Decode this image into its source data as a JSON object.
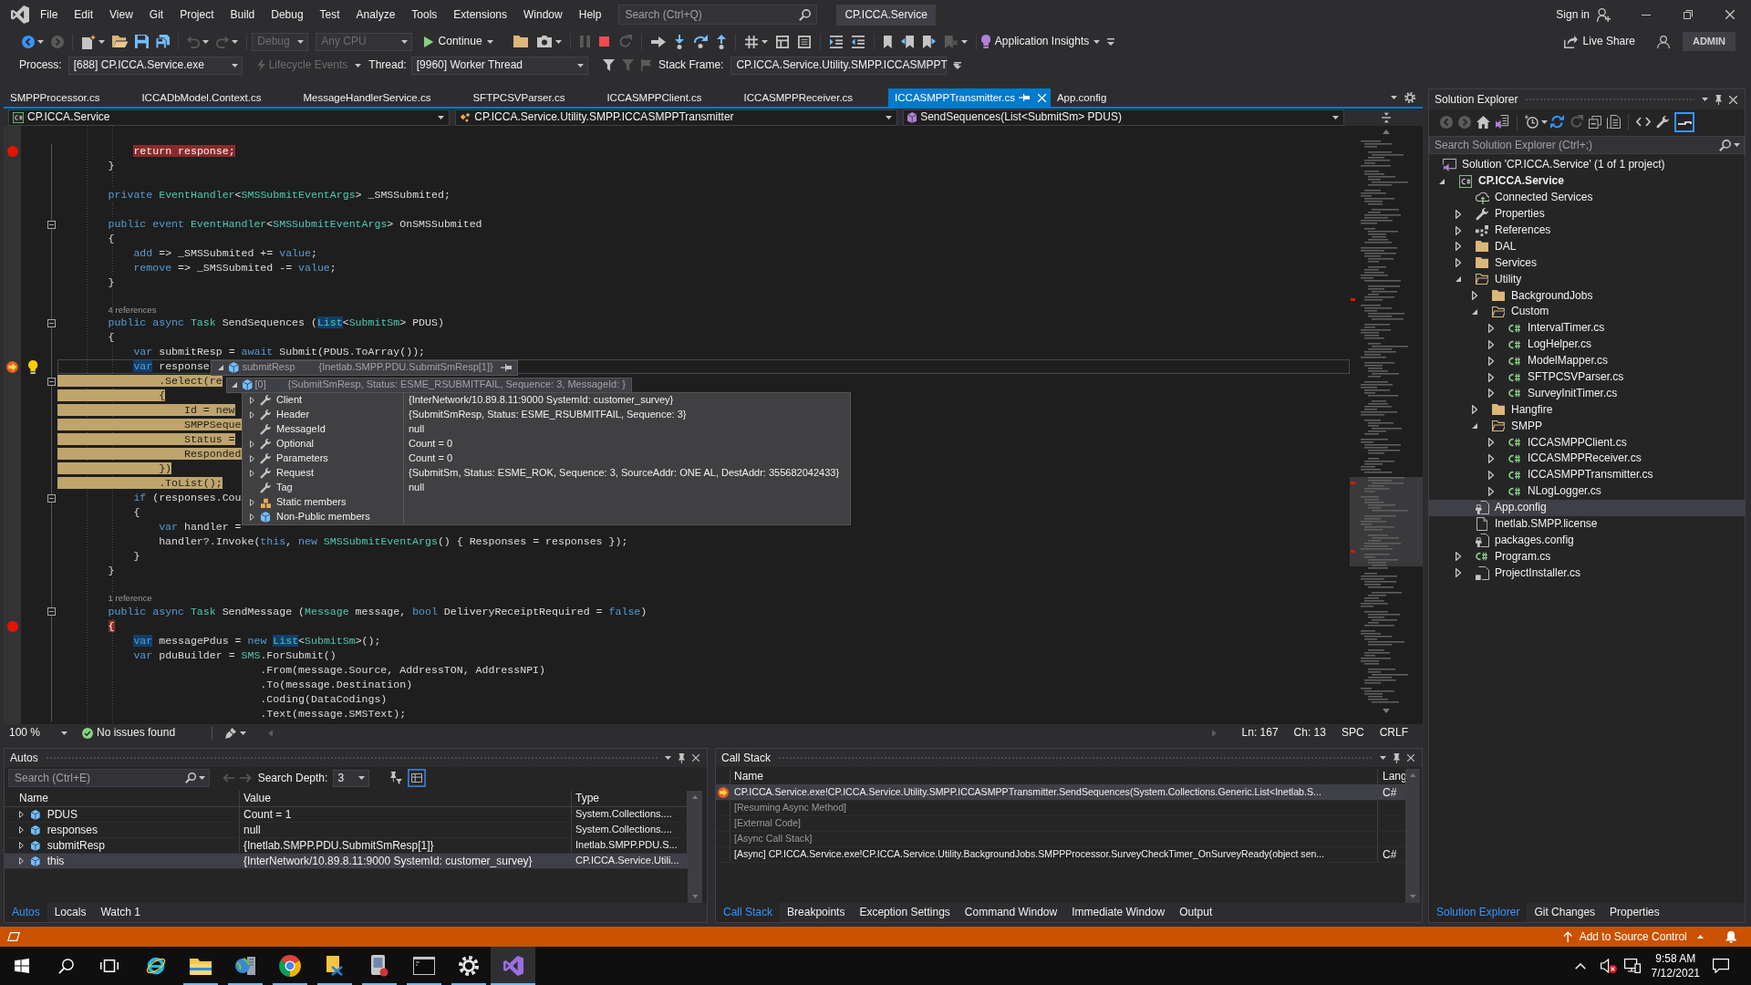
{
  "title_bar": {
    "menu": [
      "File",
      "Edit",
      "View",
      "Git",
      "Project",
      "Build",
      "Debug",
      "Test",
      "Analyze",
      "Tools",
      "Extensions",
      "Window",
      "Help"
    ],
    "search": {
      "placeholder": "Search (Ctrl+Q)"
    },
    "solution_name": "CP.ICCA.Service",
    "sign_in": "Sign in"
  },
  "toolbar": {
    "configuration": {
      "value": "Debug",
      "disabled": true
    },
    "platform": {
      "value": "Any CPU",
      "disabled": true
    },
    "continue": "Continue",
    "insights": "Application Insights",
    "live_share": "Live Share",
    "account": "ADMIN"
  },
  "debug_location": {
    "process_label": "Process:",
    "process": "[688] CP.ICCA.Service.exe",
    "lifecycle": {
      "label": "Lifecycle Events",
      "disabled": true
    },
    "thread_label": "Thread:",
    "thread": "[9960] Worker Thread",
    "stack_frame_label": "Stack Frame:",
    "stack_frame": "CP.ICCA.Service.Utility.SMPP.ICCASMPPT"
  },
  "document_tabs": [
    {
      "label": "SMPPProcessor.cs",
      "selected": false
    },
    {
      "label": "ICCADbModel.Context.cs",
      "selected": false
    },
    {
      "label": "MessageHandlerService.cs",
      "selected": false
    },
    {
      "label": "SFTPCSVParser.cs",
      "selected": false
    },
    {
      "label": "ICCASMPPClient.cs",
      "selected": false
    },
    {
      "label": "ICCASMPPReceiver.cs",
      "selected": false
    },
    {
      "label": "ICCASMPPTransmitter.cs",
      "selected": true
    },
    {
      "label": "App.config",
      "selected": false
    }
  ],
  "editor": {
    "navigation": [
      "CP.ICCA.Service",
      "CP.ICCA.Service.Utility.SMPP.ICCASMPPTransmitter",
      "SendSequences(List<SubmitSm> PDUS)"
    ],
    "lines": [
      {
        "kind": "breakpoint",
        "fold": false,
        "tokens": [
          {
            "text": "            return",
            "kind": "keyword"
          },
          {
            "text": " response;",
            "kind": "plain"
          }
        ]
      },
      {
        "kind": "code",
        "fold": false,
        "tokens": [
          {
            "text": "        }",
            "kind": "plain"
          }
        ]
      },
      {
        "kind": "blank"
      },
      {
        "kind": "code",
        "fold": false,
        "tokens": [
          {
            "text": "        private ",
            "kind": "keyword"
          },
          {
            "text": "EventHandler",
            "kind": "type"
          },
          {
            "text": "<",
            "kind": "plain"
          },
          {
            "text": "SMSSubmitEventArgs",
            "kind": "type"
          },
          {
            "text": "> _SMSSubmited;",
            "kind": "plain"
          }
        ]
      },
      {
        "kind": "blank"
      },
      {
        "kind": "code",
        "fold": true,
        "tokens": [
          {
            "text": "        public event ",
            "kind": "keyword"
          },
          {
            "text": "EventHandler",
            "kind": "type"
          },
          {
            "text": "<",
            "kind": "plain"
          },
          {
            "text": "SMSSubmitEventArgs",
            "kind": "type"
          },
          {
            "text": "> OnSMSSubmited",
            "kind": "plain"
          }
        ]
      },
      {
        "kind": "code",
        "fold": false,
        "tokens": [
          {
            "text": "        {",
            "kind": "plain"
          }
        ]
      },
      {
        "kind": "code",
        "fold": false,
        "tokens": [
          {
            "text": "            add",
            "kind": "keyword"
          },
          {
            "text": " => _SMSSubmited += ",
            "kind": "plain"
          },
          {
            "text": "value",
            "kind": "keyword"
          },
          {
            "text": ";",
            "kind": "plain"
          }
        ]
      },
      {
        "kind": "code",
        "fold": false,
        "tokens": [
          {
            "text": "            remove",
            "kind": "keyword"
          },
          {
            "text": " => _SMSSubmited -= ",
            "kind": "plain"
          },
          {
            "text": "value",
            "kind": "keyword"
          },
          {
            "text": ";",
            "kind": "plain"
          }
        ]
      },
      {
        "kind": "code",
        "fold": false,
        "tokens": [
          {
            "text": "        }",
            "kind": "plain"
          }
        ]
      },
      {
        "kind": "blank"
      },
      {
        "kind": "lens",
        "tokens": [
          {
            "text": "        4 references",
            "kind": "plain"
          }
        ]
      },
      {
        "kind": "code",
        "fold": true,
        "tokens": [
          {
            "text": "        public async ",
            "kind": "keyword"
          },
          {
            "text": "Task",
            "kind": "type"
          },
          {
            "text": " SendSequences (",
            "kind": "plain"
          },
          {
            "text": "List",
            "kind": "typeref"
          },
          {
            "text": "<",
            "kind": "plain"
          },
          {
            "text": "SubmitSm",
            "kind": "type"
          },
          {
            "text": "> PDUS)",
            "kind": "plain"
          }
        ]
      },
      {
        "kind": "code",
        "fold": false,
        "tokens": [
          {
            "text": "        {",
            "kind": "plain"
          }
        ]
      },
      {
        "kind": "code",
        "fold": false,
        "tokens": [
          {
            "text": "            var",
            "kind": "keyword"
          },
          {
            "text": " submitResp = ",
            "kind": "plain"
          },
          {
            "text": "await",
            "kind": "keyword"
          },
          {
            "text": " Submit(PDUS.ToArray());",
            "kind": "plain"
          }
        ]
      },
      {
        "kind": "current",
        "fold": false,
        "tokens": [
          {
            "text": "            var",
            "kind": "keywordref"
          },
          {
            "text": " response",
            "kind": "plain"
          }
        ]
      },
      {
        "kind": "statement",
        "fold": true,
        "tokens": [
          {
            "text": "                .Select(re",
            "kind": "plain"
          }
        ]
      },
      {
        "kind": "statement",
        "fold": false,
        "tokens": [
          {
            "text": "                {",
            "kind": "plain"
          }
        ]
      },
      {
        "kind": "statement",
        "fold": false,
        "tokens": [
          {
            "text": "                    Id = ",
            "kind": "plain"
          },
          {
            "text": "new",
            "kind": "keyword"
          }
        ]
      },
      {
        "kind": "statement",
        "fold": false,
        "tokens": [
          {
            "text": "                    SMPPSeque",
            "kind": "plain"
          }
        ]
      },
      {
        "kind": "statement",
        "fold": false,
        "tokens": [
          {
            "text": "                    Status =",
            "kind": "plain"
          }
        ]
      },
      {
        "kind": "statement",
        "fold": false,
        "tokens": [
          {
            "text": "                    Responded",
            "kind": "plain"
          }
        ]
      },
      {
        "kind": "statement",
        "fold": false,
        "tokens": [
          {
            "text": "                })",
            "kind": "plain"
          }
        ]
      },
      {
        "kind": "statement",
        "fold": false,
        "tokens": [
          {
            "text": "                .ToList();",
            "kind": "plain"
          }
        ]
      },
      {
        "kind": "code",
        "fold": true,
        "tokens": [
          {
            "text": "            if",
            "kind": "keyword"
          },
          {
            "text": " (responses.Cou",
            "kind": "plain"
          }
        ]
      },
      {
        "kind": "code",
        "fold": false,
        "tokens": [
          {
            "text": "            {",
            "kind": "plain"
          }
        ]
      },
      {
        "kind": "code",
        "fold": false,
        "tokens": [
          {
            "text": "                var",
            "kind": "keyword"
          },
          {
            "text": " handler =",
            "kind": "plain"
          }
        ]
      },
      {
        "kind": "code",
        "fold": false,
        "tokens": [
          {
            "text": "                handler?.Invoke(",
            "kind": "plain"
          },
          {
            "text": "this",
            "kind": "keyword"
          },
          {
            "text": ", ",
            "kind": "plain"
          },
          {
            "text": "new ",
            "kind": "keyword"
          },
          {
            "text": "SMSSubmitEventArgs",
            "kind": "type"
          },
          {
            "text": "() { Responses = responses });",
            "kind": "plain"
          }
        ]
      },
      {
        "kind": "code",
        "fold": false,
        "tokens": [
          {
            "text": "            }",
            "kind": "plain"
          }
        ]
      },
      {
        "kind": "code",
        "fold": false,
        "tokens": [
          {
            "text": "        }",
            "kind": "plain"
          }
        ]
      },
      {
        "kind": "blank"
      },
      {
        "kind": "lens",
        "tokens": [
          {
            "text": "        1 reference",
            "kind": "plain"
          }
        ]
      },
      {
        "kind": "code",
        "fold": true,
        "tokens": [
          {
            "text": "        public async ",
            "kind": "keyword"
          },
          {
            "text": "Task",
            "kind": "type"
          },
          {
            "text": " SendMessage (",
            "kind": "plain"
          },
          {
            "text": "Message",
            "kind": "type"
          },
          {
            "text": " message, ",
            "kind": "plain"
          },
          {
            "text": "bool",
            "kind": "keyword"
          },
          {
            "text": " DeliveryReceiptRequired = ",
            "kind": "plain"
          },
          {
            "text": "false",
            "kind": "keyword"
          },
          {
            "text": ")",
            "kind": "plain"
          }
        ]
      },
      {
        "kind": "breakpoint",
        "fold": false,
        "tokens": [
          {
            "text": "        {",
            "kind": "plain"
          }
        ]
      },
      {
        "kind": "code",
        "fold": false,
        "tokens": [
          {
            "text": "            var",
            "kind": "keywordref"
          },
          {
            "text": " messagePdus = ",
            "kind": "plain"
          },
          {
            "text": "new ",
            "kind": "keyword"
          },
          {
            "text": "List",
            "kind": "typeref"
          },
          {
            "text": "<",
            "kind": "plain"
          },
          {
            "text": "SubmitSm",
            "kind": "type"
          },
          {
            "text": ">();",
            "kind": "plain"
          }
        ]
      },
      {
        "kind": "code",
        "fold": false,
        "tokens": [
          {
            "text": "            var",
            "kind": "keyword"
          },
          {
            "text": " pduBuilder = ",
            "kind": "plain"
          },
          {
            "text": "SMS",
            "kind": "type"
          },
          {
            "text": ".ForSubmit()",
            "kind": "plain"
          }
        ]
      },
      {
        "kind": "code",
        "fold": false,
        "tokens": [
          {
            "text": "                                .From(message.Source, AddressTON, AddressNPI)",
            "kind": "plain"
          }
        ]
      },
      {
        "kind": "code",
        "fold": false,
        "tokens": [
          {
            "text": "                                .To(message.Destination)",
            "kind": "plain"
          }
        ]
      },
      {
        "kind": "code",
        "fold": false,
        "tokens": [
          {
            "text": "                                .Coding(DataCodings)",
            "kind": "plain"
          }
        ]
      },
      {
        "kind": "code",
        "fold": false,
        "tokens": [
          {
            "text": "                                .Text(message.SMSText);",
            "kind": "plain"
          }
        ]
      }
    ],
    "datatip": {
      "rows": [
        {
          "name": "submitResp",
          "value": "{Inetlab.SMPP.PDU.SubmitSmResp[1]}",
          "expanded": true
        },
        {
          "name": "[0]",
          "value": "{SubmitSmResp, Status: ESME_RSUBMITFAIL, Sequence: 3, MessageId: }",
          "expanded": true
        }
      ],
      "members": [
        {
          "name": "Client",
          "value": "{InterNetwork/10.89.8.11:9000 SystemId: customer_survey}",
          "kind": "property",
          "expanded": false
        },
        {
          "name": "Header",
          "value": "{SubmitSmResp, Status: ESME_RSUBMITFAIL, Sequence: 3}",
          "kind": "property",
          "expanded": false
        },
        {
          "name": "MessageId",
          "value": "null",
          "kind": "property"
        },
        {
          "name": "Optional",
          "value": "Count = 0",
          "kind": "property",
          "expanded": false
        },
        {
          "name": "Parameters",
          "value": "Count = 0",
          "kind": "property",
          "expanded": false
        },
        {
          "name": "Request",
          "value": "{SubmitSm, Status: ESME_ROK, Sequence: 3, SourceAddr: ONE AL, DestAddr: 355682042433}",
          "kind": "property",
          "expanded": false
        },
        {
          "name": "Tag",
          "value": "null",
          "kind": "property"
        },
        {
          "name": "Static members",
          "kind": "static",
          "expanded": false
        },
        {
          "name": "Non-Public members",
          "kind": "nonpublic",
          "expanded": false
        }
      ]
    },
    "status": {
      "zoom": "100 %",
      "issues": "No issues found",
      "line": "Ln: 167",
      "column": "Ch: 13",
      "whitespace": "SPC",
      "line_ending": "CRLF"
    }
  },
  "autos": {
    "title": "Autos",
    "search": {
      "placeholder": "Search (Ctrl+E)"
    },
    "search_depth_label": "Search Depth:",
    "search_depth": "3",
    "columns": [
      "Name",
      "Value",
      "Type"
    ],
    "rows": [
      {
        "name": "PDUS",
        "value": "Count = 1",
        "type": "System.Collections....",
        "expanded": false,
        "selected": false
      },
      {
        "name": "responses",
        "value": "null",
        "type": "System.Collections....",
        "expanded": false,
        "selected": false
      },
      {
        "name": "submitResp",
        "value": "{Inetlab.SMPP.PDU.SubmitSmResp[1]}",
        "type": "Inetlab.SMPP.PDU.S...",
        "expanded": false,
        "selected": false
      },
      {
        "name": "this",
        "value": "{InterNetwork/10.89.8.11:9000 SystemId: customer_survey}",
        "type": "CP.ICCA.Service.Utili...",
        "expanded": false,
        "selected": true
      }
    ],
    "tabs": [
      {
        "label": "Autos",
        "selected": true
      },
      {
        "label": "Locals",
        "selected": false
      },
      {
        "label": "Watch 1",
        "selected": false
      }
    ]
  },
  "call_stack": {
    "title": "Call Stack",
    "columns": [
      "Name",
      "Lang"
    ],
    "rows": [
      {
        "name": "CP.ICCA.Service.exe!CP.ICCA.Service.Utility.SMPP.ICCASMPPTransmitter.SendSequences(System.Collections.Generic.List<Inetlab.S...",
        "language": "C#",
        "kind": "current",
        "selected": true
      },
      {
        "name": "[Resuming Async Method]",
        "kind": "external",
        "selected": false
      },
      {
        "name": "[External Code]",
        "kind": "external",
        "selected": false
      },
      {
        "name": "[Async Call Stack]",
        "kind": "external",
        "selected": false
      },
      {
        "name": "[Async] CP.ICCA.Service.exe!CP.ICCA.Service.Utility.BackgroundJobs.SMPPProcessor.SurveyCheckTimer_OnSurveyReady(object sen...",
        "language": "C#",
        "kind": "frame",
        "selected": false
      }
    ],
    "tabs": [
      {
        "label": "Call Stack",
        "selected": true
      },
      {
        "label": "Breakpoints",
        "selected": false
      },
      {
        "label": "Exception Settings",
        "selected": false
      },
      {
        "label": "Command Window",
        "selected": false
      },
      {
        "label": "Immediate Window",
        "selected": false
      },
      {
        "label": "Output",
        "selected": false
      }
    ]
  },
  "solution_explorer": {
    "title": "Solution Explorer",
    "search": {
      "placeholder": "Search Solution Explorer (Ctrl+;)"
    },
    "tree": [
      {
        "label": "Solution 'CP.ICCA.Service' (1 of 1 project)",
        "kind": "solution",
        "selected": false,
        "children": [
          {
            "label": "CP.ICCA.Service",
            "kind": "project",
            "expanded": true,
            "selected": false,
            "children": [
              {
                "label": "Connected Services",
                "kind": "connected",
                "selected": false
              },
              {
                "label": "Properties",
                "kind": "properties",
                "expanded": false,
                "selected": false
              },
              {
                "label": "References",
                "kind": "references",
                "expanded": false,
                "selected": false
              },
              {
                "label": "DAL",
                "kind": "folder",
                "expanded": false,
                "selected": false
              },
              {
                "label": "Services",
                "kind": "folder",
                "expanded": false,
                "selected": false
              },
              {
                "label": "Utility",
                "kind": "folder",
                "expanded": true,
                "selected": false,
                "children": [
                  {
                    "label": "BackgroundJobs",
                    "kind": "folder",
                    "expanded": false,
                    "selected": false
                  },
                  {
                    "label": "Custom",
                    "kind": "folder",
                    "expanded": true,
                    "selected": false,
                    "children": [
                      {
                        "label": "IntervalTimer.cs",
                        "kind": "csharp",
                        "expanded": false,
                        "selected": false
                      },
                      {
                        "label": "LogHelper.cs",
                        "kind": "csharp",
                        "expanded": false,
                        "selected": false
                      },
                      {
                        "label": "ModelMapper.cs",
                        "kind": "csharp",
                        "expanded": false,
                        "selected": false
                      },
                      {
                        "label": "SFTPCSVParser.cs",
                        "kind": "csharp",
                        "expanded": false,
                        "selected": false
                      },
                      {
                        "label": "SurveyInitTimer.cs",
                        "kind": "csharp",
                        "expanded": false,
                        "selected": false
                      }
                    ]
                  },
                  {
                    "label": "Hangfire",
                    "kind": "folder",
                    "expanded": false,
                    "selected": false
                  },
                  {
                    "label": "SMPP",
                    "kind": "folder",
                    "expanded": true,
                    "selected": false,
                    "children": [
                      {
                        "label": "ICCASMPPClient.cs",
                        "kind": "csharp",
                        "expanded": false,
                        "selected": false
                      },
                      {
                        "label": "ICCASMPPReceiver.cs",
                        "kind": "csharp",
                        "expanded": false,
                        "selected": false
                      },
                      {
                        "label": "ICCASMPPTransmitter.cs",
                        "kind": "csharp",
                        "expanded": false,
                        "selected": false
                      },
                      {
                        "label": "NLogLogger.cs",
                        "kind": "csharp",
                        "expanded": false,
                        "selected": false
                      }
                    ]
                  }
                ]
              },
              {
                "label": "App.config",
                "kind": "config",
                "selected": true
              },
              {
                "label": "Inetlab.SMPP.license",
                "kind": "file",
                "selected": false
              },
              {
                "label": "packages.config",
                "kind": "config",
                "selected": false
              },
              {
                "label": "Program.cs",
                "kind": "csharp",
                "expanded": false,
                "selected": false
              },
              {
                "label": "ProjectInstaller.cs",
                "kind": "installer",
                "expanded": false,
                "selected": false
              }
            ]
          }
        ]
      }
    ],
    "tabs": [
      {
        "label": "Solution Explorer",
        "selected": true
      },
      {
        "label": "Git Changes",
        "selected": false
      },
      {
        "label": "Properties",
        "selected": false
      }
    ]
  },
  "status_bar": {
    "source_control": "Add to Source Control"
  },
  "taskbar": {
    "apps": [
      {
        "kind": "browser",
        "running": false,
        "selected": false
      },
      {
        "kind": "folder",
        "running": true,
        "selected": false
      },
      {
        "kind": "globe",
        "running": true,
        "selected": false
      },
      {
        "kind": "circle",
        "running": true,
        "selected": false
      },
      {
        "kind": "transfer",
        "running": true,
        "selected": false
      },
      {
        "kind": "document",
        "running": true,
        "selected": false
      },
      {
        "kind": "terminal",
        "running": true,
        "selected": false
      },
      {
        "kind": "gear",
        "running": true,
        "selected": false
      },
      {
        "kind": "studio",
        "running": true,
        "selected": true
      }
    ],
    "time": "9:58 AM",
    "date": "7/12/2021"
  }
}
